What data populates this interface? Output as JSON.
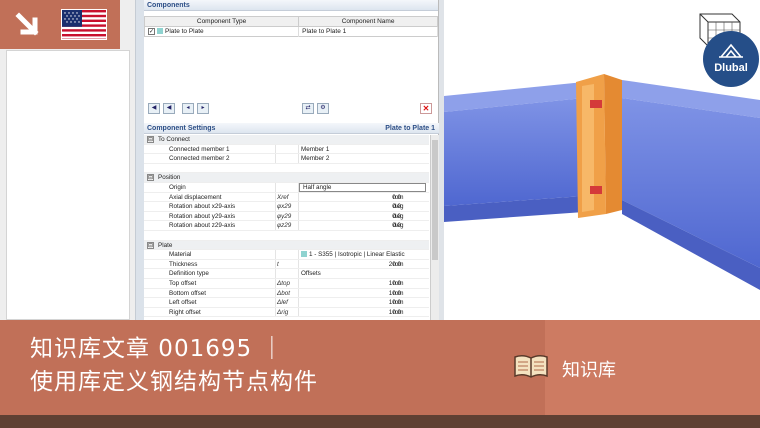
{
  "components": {
    "header": "Components",
    "columns": [
      "Component Type",
      "Component Name"
    ],
    "rows": [
      {
        "type": "Plate to Plate",
        "name": "Plate to Plate 1",
        "checked": true
      }
    ]
  },
  "settings": {
    "header": "Component Settings",
    "header_right": "Plate to Plate 1",
    "rows": [
      {
        "kind": "group",
        "toggle": "⊟",
        "label": "To Connect"
      },
      {
        "kind": "item",
        "label": "Connected member 1",
        "symbol": "",
        "value": "Member 1",
        "unit": "",
        "align": "left"
      },
      {
        "kind": "item",
        "label": "Connected member 2",
        "symbol": "",
        "value": "Member 2",
        "unit": "",
        "align": "left"
      },
      {
        "kind": "blank"
      },
      {
        "kind": "group",
        "toggle": "⊟",
        "label": "Position"
      },
      {
        "kind": "item",
        "label": "Origin",
        "symbol": "",
        "value": "Half angle",
        "unit": "",
        "align": "box"
      },
      {
        "kind": "item",
        "label": "Axial displacement",
        "symbol": "Xref",
        "value": "0.0",
        "unit": "mm",
        "align": "right"
      },
      {
        "kind": "item",
        "label": "Rotation about x29-axis",
        "symbol": "φx29",
        "value": "0.0",
        "unit": "deg",
        "align": "right"
      },
      {
        "kind": "item",
        "label": "Rotation about y29-axis",
        "symbol": "φy29",
        "value": "0.0",
        "unit": "deg",
        "align": "right"
      },
      {
        "kind": "item",
        "label": "Rotation about z29-axis",
        "symbol": "φz29",
        "value": "0.0",
        "unit": "deg",
        "align": "right"
      },
      {
        "kind": "blank"
      },
      {
        "kind": "group",
        "toggle": "⊟",
        "label": "Plate"
      },
      {
        "kind": "item",
        "label": "Material",
        "symbol": "",
        "value": "1 - S355 | Isotropic | Linear Elastic",
        "unit": "",
        "align": "left",
        "swatch": true
      },
      {
        "kind": "item",
        "label": "Thickness",
        "symbol": "t",
        "value": "20.0",
        "unit": "mm",
        "align": "right"
      },
      {
        "kind": "item",
        "label": "Definition type",
        "symbol": "",
        "value": "Offsets",
        "unit": "",
        "align": "left"
      },
      {
        "kind": "item",
        "label": "Top offset",
        "symbol": "Δtop",
        "value": "10.0",
        "unit": "mm",
        "align": "right"
      },
      {
        "kind": "item",
        "label": "Bottom offset",
        "symbol": "Δbot",
        "value": "10.0",
        "unit": "mm",
        "align": "right"
      },
      {
        "kind": "item",
        "label": "Left offset",
        "symbol": "Δlef",
        "value": "10.0",
        "unit": "mm",
        "align": "right"
      },
      {
        "kind": "item",
        "label": "Right offset",
        "symbol": "Δrig",
        "value": "10.0",
        "unit": "mm",
        "align": "right"
      }
    ]
  },
  "logo": {
    "text": "Dlubal"
  },
  "banner": {
    "line1": "知识库文章 001695 ｜",
    "line2": "使用库定义钢结构节点构件",
    "kb_label": "知识库"
  },
  "colors": {
    "accent": "#c17058",
    "brand": "#254e88",
    "member": "#5b74d8",
    "plate": "#f0a048"
  }
}
